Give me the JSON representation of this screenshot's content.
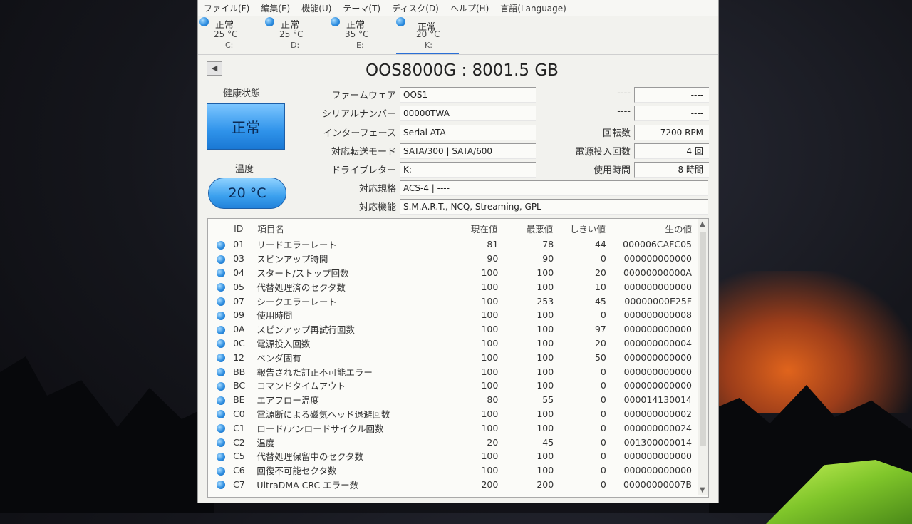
{
  "menu": [
    "ファイル(F)",
    "編集(E)",
    "機能(U)",
    "テーマ(T)",
    "ディスク(D)",
    "ヘルプ(H)",
    "言語(Language)"
  ],
  "disks": [
    {
      "status": "正常",
      "temp": "25 °C",
      "letter": "C:"
    },
    {
      "status": "正常",
      "temp": "25 °C",
      "letter": "D:"
    },
    {
      "status": "正常",
      "temp": "35 °C",
      "letter": "E:"
    },
    {
      "status": "正常",
      "temp": "20 °C",
      "letter": "K:"
    }
  ],
  "model_title": "OOS8000G : 8001.5 GB",
  "health": {
    "label": "健康状態",
    "value": "正常"
  },
  "temperature": {
    "label": "温度",
    "value": "20 °C"
  },
  "fields": {
    "firmware": {
      "label": "ファームウェア",
      "value": "OOS1"
    },
    "serial": {
      "label": "シリアルナンバー",
      "value": "00000TWA"
    },
    "interface": {
      "label": "インターフェース",
      "value": "Serial ATA"
    },
    "transfer": {
      "label": "対応転送モード",
      "value": "SATA/300 | SATA/600"
    },
    "drive_letter": {
      "label": "ドライブレター",
      "value": "K:"
    },
    "standard": {
      "label": "対応規格",
      "value": "ACS-4 | ----"
    },
    "features": {
      "label": "対応機能",
      "value": "S.M.A.R.T., NCQ, Streaming, GPL"
    }
  },
  "right_fields": {
    "blank1": {
      "label": "----",
      "value": "----"
    },
    "blank2": {
      "label": "----",
      "value": "----"
    },
    "rotation": {
      "label": "回転数",
      "value": "7200 RPM"
    },
    "power_count": {
      "label": "電源投入回数",
      "value": "4 回"
    },
    "power_hours": {
      "label": "使用時間",
      "value": "8 時間"
    }
  },
  "table": {
    "headers": {
      "id": "ID",
      "name": "項目名",
      "current": "現在値",
      "worst": "最悪値",
      "threshold": "しきい値",
      "raw": "生の値"
    },
    "rows": [
      {
        "id": "01",
        "name": "リードエラーレート",
        "current": "81",
        "worst": "78",
        "threshold": "44",
        "raw": "000006CAFC05"
      },
      {
        "id": "03",
        "name": "スピンアップ時間",
        "current": "90",
        "worst": "90",
        "threshold": "0",
        "raw": "000000000000"
      },
      {
        "id": "04",
        "name": "スタート/ストップ回数",
        "current": "100",
        "worst": "100",
        "threshold": "20",
        "raw": "00000000000A"
      },
      {
        "id": "05",
        "name": "代替処理済のセクタ数",
        "current": "100",
        "worst": "100",
        "threshold": "10",
        "raw": "000000000000"
      },
      {
        "id": "07",
        "name": "シークエラーレート",
        "current": "100",
        "worst": "253",
        "threshold": "45",
        "raw": "00000000E25F"
      },
      {
        "id": "09",
        "name": "使用時間",
        "current": "100",
        "worst": "100",
        "threshold": "0",
        "raw": "000000000008"
      },
      {
        "id": "0A",
        "name": "スピンアップ再試行回数",
        "current": "100",
        "worst": "100",
        "threshold": "97",
        "raw": "000000000000"
      },
      {
        "id": "0C",
        "name": "電源投入回数",
        "current": "100",
        "worst": "100",
        "threshold": "20",
        "raw": "000000000004"
      },
      {
        "id": "12",
        "name": "ベンダ固有",
        "current": "100",
        "worst": "100",
        "threshold": "50",
        "raw": "000000000000"
      },
      {
        "id": "BB",
        "name": "報告された訂正不可能エラー",
        "current": "100",
        "worst": "100",
        "threshold": "0",
        "raw": "000000000000"
      },
      {
        "id": "BC",
        "name": "コマンドタイムアウト",
        "current": "100",
        "worst": "100",
        "threshold": "0",
        "raw": "000000000000"
      },
      {
        "id": "BE",
        "name": "エアフロー温度",
        "current": "80",
        "worst": "55",
        "threshold": "0",
        "raw": "000014130014"
      },
      {
        "id": "C0",
        "name": "電源断による磁気ヘッド退避回数",
        "current": "100",
        "worst": "100",
        "threshold": "0",
        "raw": "000000000002"
      },
      {
        "id": "C1",
        "name": "ロード/アンロードサイクル回数",
        "current": "100",
        "worst": "100",
        "threshold": "0",
        "raw": "000000000024"
      },
      {
        "id": "C2",
        "name": "温度",
        "current": "20",
        "worst": "45",
        "threshold": "0",
        "raw": "001300000014"
      },
      {
        "id": "C5",
        "name": "代替処理保留中のセクタ数",
        "current": "100",
        "worst": "100",
        "threshold": "0",
        "raw": "000000000000"
      },
      {
        "id": "C6",
        "name": "回復不可能セクタ数",
        "current": "100",
        "worst": "100",
        "threshold": "0",
        "raw": "000000000000"
      },
      {
        "id": "C7",
        "name": "UltraDMA CRC エラー数",
        "current": "200",
        "worst": "200",
        "threshold": "0",
        "raw": "00000000007B"
      }
    ]
  }
}
